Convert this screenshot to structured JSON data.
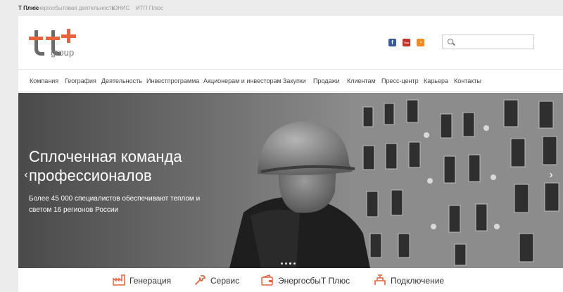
{
  "topbar": {
    "links": [
      "Т Плюс",
      "Энергосбытовая деятельность",
      "ЮНИС",
      "ИТП Плюс"
    ]
  },
  "header": {
    "logo_text": "group",
    "social": [
      "facebook-icon",
      "youtube-icon",
      "rss-icon"
    ],
    "social_glyphs": {
      "facebook": "f",
      "youtube": "You",
      "rss": "◔"
    },
    "search_placeholder": ""
  },
  "nav": {
    "items": [
      "Компания",
      "География",
      "Деятельность",
      "Инвестпрограмма",
      "Акционерам и инвесторам",
      "Закупки",
      "Продажи",
      "Клиентам",
      "Пресс-центр",
      "Карьера",
      "Контакты"
    ]
  },
  "hero": {
    "title": "Сплоченная команда профессионалов",
    "subtitle": "Более 45 000 специалистов обеспечивают теплом и светом 16 регионов России",
    "prev_arrow": "‹",
    "next_arrow": "›",
    "slide_count": 4,
    "active_slide": 2
  },
  "services": {
    "items": [
      "Генерация",
      "Сервис",
      "ЭнергосбыТ Плюс",
      "Подключение"
    ]
  },
  "colors": {
    "accent": "#e8623a",
    "logo_dark": "#6b6b6b"
  }
}
